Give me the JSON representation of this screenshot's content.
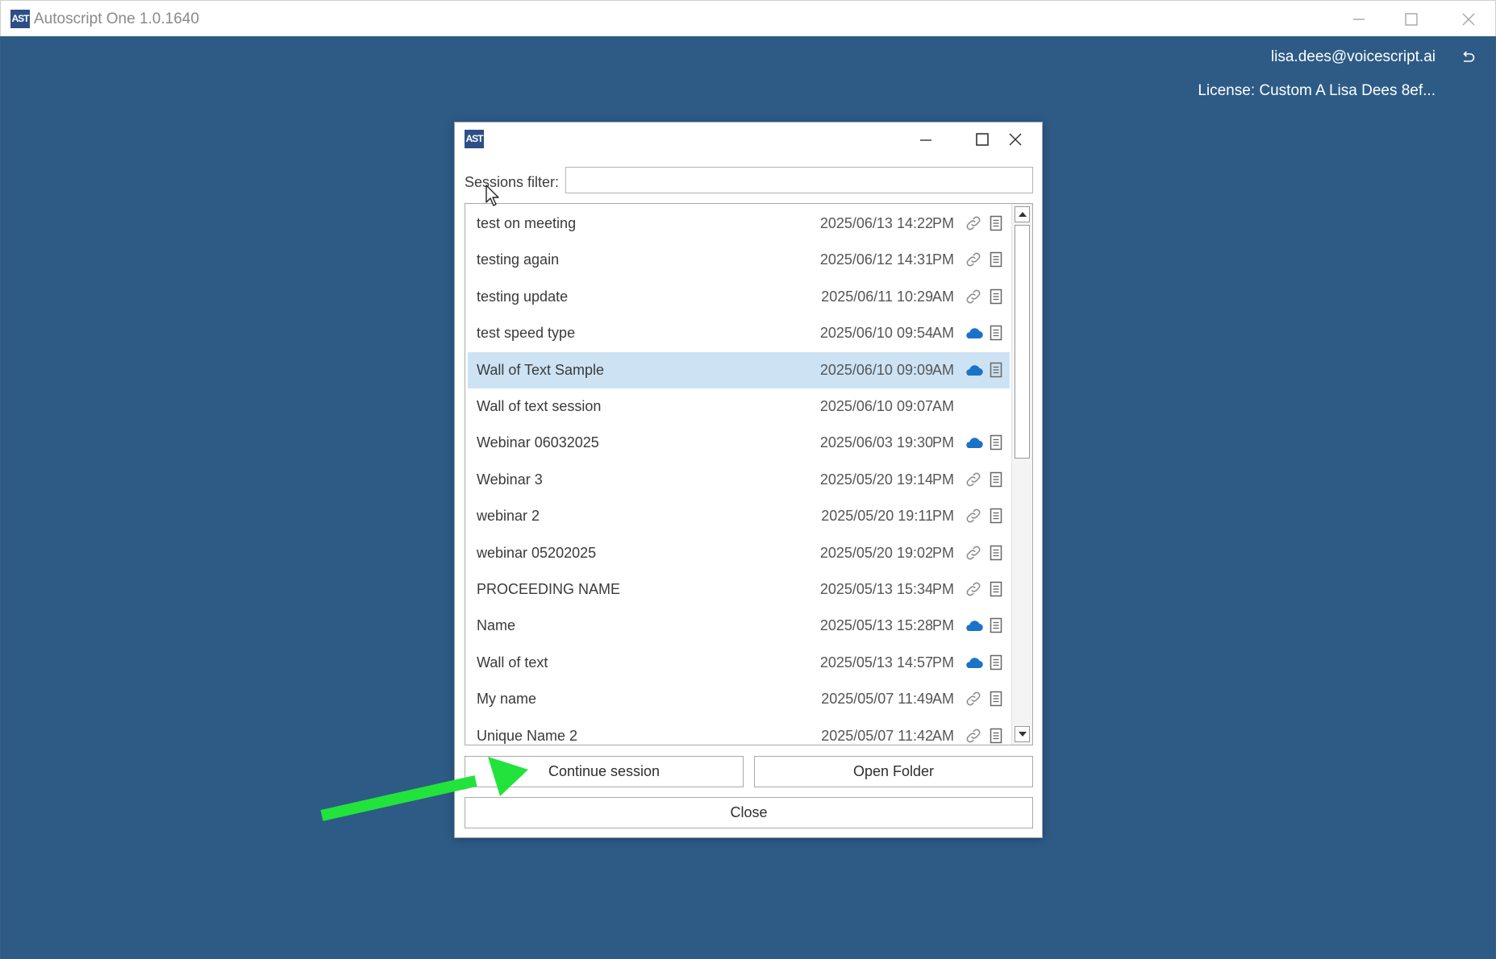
{
  "app": {
    "logo_text": "AST",
    "title": "Autoscript One 1.0.1640",
    "user_email": "lisa.dees@voicescript.ai",
    "license": "License: Custom A Lisa Dees 8ef..."
  },
  "dialog": {
    "logo_text": "AST",
    "filter_label": "Sessions filter:",
    "filter_value": "",
    "sessions": [
      {
        "name": "test on meeting",
        "date": "2025/06/13 14:22",
        "ampm": "PM",
        "status_icon": "link-icon"
      },
      {
        "name": "testing again",
        "date": "2025/06/12 14:31",
        "ampm": "PM",
        "status_icon": "link-icon"
      },
      {
        "name": "testing update",
        "date": "2025/06/11 10:29",
        "ampm": "AM",
        "status_icon": "link-icon"
      },
      {
        "name": "test speed type",
        "date": "2025/06/10 09:54",
        "ampm": "AM",
        "status_icon": "cloud-icon"
      },
      {
        "name": "Wall of Text Sample",
        "date": "2025/06/10 09:09",
        "ampm": "AM",
        "status_icon": "cloud-icon",
        "selected": true
      },
      {
        "name": "Wall of text session",
        "date": "2025/06/10 09:07",
        "ampm": "AM",
        "status_icon": "none"
      },
      {
        "name": "Webinar 06032025",
        "date": "2025/06/03 19:30",
        "ampm": "PM",
        "status_icon": "cloud-icon"
      },
      {
        "name": "Webinar 3",
        "date": "2025/05/20 19:14",
        "ampm": "PM",
        "status_icon": "link-icon"
      },
      {
        "name": "webinar 2",
        "date": "2025/05/20 19:11",
        "ampm": "PM",
        "status_icon": "link-icon"
      },
      {
        "name": "webinar 05202025",
        "date": "2025/05/20 19:02",
        "ampm": "PM",
        "status_icon": "link-icon"
      },
      {
        "name": "PROCEEDING NAME",
        "date": "2025/05/13 15:34",
        "ampm": "PM",
        "status_icon": "link-icon"
      },
      {
        "name": "Name",
        "date": "2025/05/13 15:28",
        "ampm": "PM",
        "status_icon": "cloud-icon"
      },
      {
        "name": "Wall of text",
        "date": "2025/05/13 14:57",
        "ampm": "PM",
        "status_icon": "cloud-icon"
      },
      {
        "name": "My name",
        "date": "2025/05/07 11:49",
        "ampm": "AM",
        "status_icon": "link-icon"
      },
      {
        "name": "Unique Name 2",
        "date": "2025/05/07 11:42",
        "ampm": "AM",
        "status_icon": "link-icon"
      }
    ],
    "buttons": {
      "continue": "Continue session",
      "open_folder": "Open Folder",
      "close": "Close"
    }
  },
  "colors": {
    "background": "#2d5b86",
    "logo": "#2d4f87",
    "selected_row": "#cde3f4",
    "cloud": "#1a73c8",
    "annotation_arrow": "#22e33c"
  }
}
